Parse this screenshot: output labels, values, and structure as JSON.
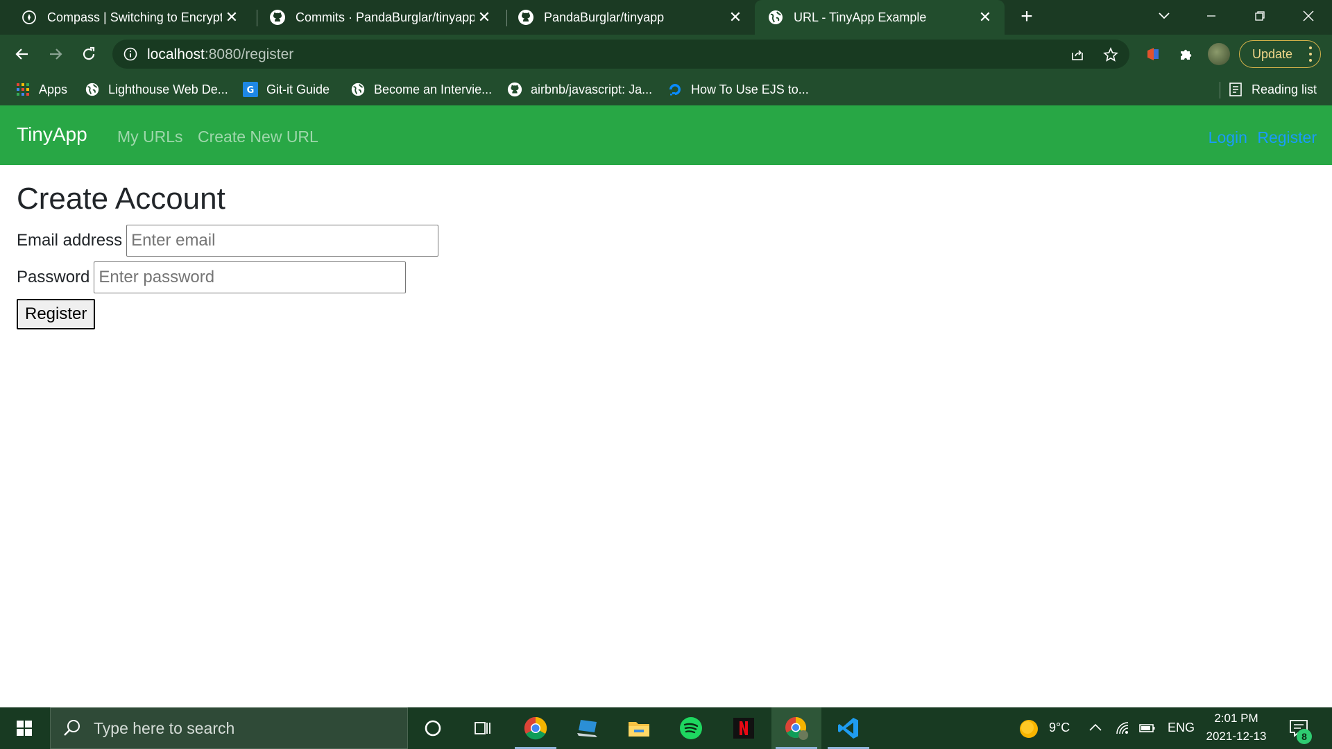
{
  "browser": {
    "tabs": [
      {
        "title": "Compass | Switching to Encrypted",
        "icon": "compass-icon",
        "active": false
      },
      {
        "title": "Commits · PandaBurglar/tinyapp",
        "icon": "github-icon",
        "active": false
      },
      {
        "title": "PandaBurglar/tinyapp",
        "icon": "github-icon",
        "active": false
      },
      {
        "title": "URL - TinyApp Example",
        "icon": "globe-icon",
        "active": true
      }
    ],
    "address": {
      "host": "localhost",
      "path": ":8080/register"
    },
    "update_label": "Update",
    "bookmarks": [
      {
        "label": "Apps",
        "icon": "apps-grid-icon"
      },
      {
        "label": "Lighthouse Web De...",
        "icon": "globe-icon"
      },
      {
        "label": "Git-it Guide",
        "icon": "g-badge-icon"
      },
      {
        "label": "Become an Intervie...",
        "icon": "globe-icon"
      },
      {
        "label": "airbnb/javascript: Ja...",
        "icon": "github-icon"
      },
      {
        "label": "How To Use EJS to...",
        "icon": "digitalocean-icon"
      }
    ],
    "reading_list_label": "Reading list"
  },
  "app": {
    "brand": "TinyApp",
    "nav_links": [
      "My URLs",
      "Create New URL"
    ],
    "auth_links": [
      "Login",
      "Register"
    ],
    "colors": {
      "navbar": "#28a745",
      "auth_link": "#1a9bfc"
    }
  },
  "form": {
    "title": "Create Account",
    "email_label": "Email address",
    "email_placeholder": "Enter email",
    "email_value": "",
    "password_label": "Password",
    "password_placeholder": "Enter password",
    "password_value": "",
    "submit_label": "Register"
  },
  "taskbar": {
    "search_placeholder": "Type here to search",
    "apps": [
      "cortana-icon",
      "task-view-icon",
      "chrome-icon",
      "laptop-app-icon",
      "file-explorer-icon",
      "spotify-icon",
      "netflix-icon",
      "chrome-profile-icon",
      "vscode-icon"
    ],
    "weather": {
      "temp": "9°C",
      "icon": "sun-icon"
    },
    "language": "ENG",
    "time": "2:01 PM",
    "date": "2021-12-13",
    "notification_count": "8"
  }
}
